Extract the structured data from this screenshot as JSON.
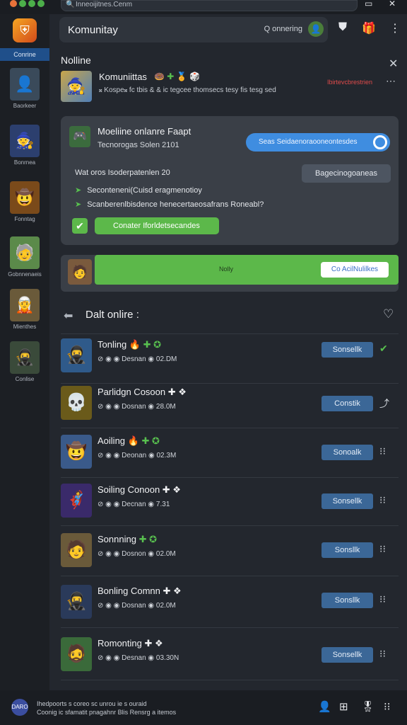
{
  "topbar": {
    "url": "Inneoijitnes.Cenm"
  },
  "rail": {
    "tab": "Conrine",
    "items": [
      {
        "label": "Baorkeer",
        "icon": "👤",
        "bg": "#3a4a5a"
      },
      {
        "label": "Bonrnea",
        "icon": "🧙",
        "bg": "#2c3f6e"
      },
      {
        "label": "Fonntag",
        "icon": "🤠",
        "bg": "#7a4a1a"
      },
      {
        "label": "Gobnnenaeis",
        "icon": "🧓",
        "bg": "#5b8a4a"
      },
      {
        "label": "Mienthes",
        "icon": "🧝",
        "bg": "#6a5a3a"
      },
      {
        "label": "Conlise",
        "icon": "🥷",
        "bg": "#3a4a3a"
      }
    ]
  },
  "header": {
    "title": "Komunitay",
    "search": "Q onnering"
  },
  "panel": {
    "title": "Nolline",
    "notif_name": "Komuniittas",
    "notif_sub": "𝄪 Kospe𝄪 fc tbis & & ic tegcee thomsecs tesy fis tesg sed",
    "notif_red": "Ibirtevcbrestrien"
  },
  "card": {
    "title": "Moeliine onlanre Faapt",
    "sub": "Tecnorogas Solen 2101",
    "pill": "Seas Seidaenoraooneontesdes",
    "question": "Wat oros Isoderpatenlen 20",
    "grey_btn": "Bagecinogoaneas",
    "bullet1": "Seconteneni(Cuisd eragmenotioy",
    "bullet2": "Scanberenlbisdence henecertaeosafrans Roneabl?",
    "green_btn": "Conater Iforldetsecandes"
  },
  "banner": {
    "label": "Nolly",
    "button": "Co AcilNulilkes"
  },
  "section": {
    "title": "Dalt onlire :"
  },
  "rows": [
    {
      "name": "Tonling",
      "badges": "🔥 ✚ ✪",
      "meta": "⊘ ◉  ◉ Desnan  ◉ 02.DM",
      "button": "Sonsellk",
      "end": "✔",
      "avatar": "🥷",
      "bg": "#2f5a8a"
    },
    {
      "name": "Parlidgn Cosoon ✚ ❖",
      "badges": "",
      "meta": "⊘ ◉  ◉ Dosnan  ◉ 28.0M",
      "button": "Constik",
      "end": "⤴",
      "avatar": "💀",
      "bg": "#6a5a1a"
    },
    {
      "name": "Aoiling",
      "badges": "🔥 ✚ ✪",
      "meta": "⊘ ◉  ◉ Deonan  ◉ 02.3M",
      "button": "Sonoalk",
      "end": "⁝⁝",
      "avatar": "🤠",
      "bg": "#3a5a8a"
    },
    {
      "name": "Soiling Conoon ✚ ❖",
      "badges": "",
      "meta": "⊘ ◉  ◉ Decnan  ◉ 7.31",
      "button": "Sonsellk",
      "end": "⁝⁝",
      "avatar": "🦸",
      "bg": "#3a2a6a"
    },
    {
      "name": "Sonnning",
      "badges": "✚ ✪",
      "meta": "⊘ ◉  ◉ Dosnon  ◉ 02.0M",
      "button": "Sonsllk",
      "end": "⁝⁝",
      "avatar": "🧑",
      "bg": "#6a5a3a"
    },
    {
      "name": "Bonling Comnn ✚ ❖",
      "badges": "",
      "meta": "⊘ ◉  ◉ Dosnan  ◉ 02.0M",
      "button": "Sonsllk",
      "end": "⁝⁝",
      "avatar": "🥷",
      "bg": "#2a3a5a"
    },
    {
      "name": "Romonting",
      "badges": "✚ ❖",
      "meta": "⊘ ◉  ◉ Desnan  ◉ 03.30N",
      "button": "Sonsellk",
      "end": "⁝⁝",
      "avatar": "🧔",
      "bg": "#3a6a3a"
    }
  ],
  "footer": {
    "line1": "Ihedpoorts s coreo sc unrou ie s ouraid",
    "line2": "Coonig ic sfamatit pnagahnr Blis Rensrg a itemos",
    "logo": "DARO"
  },
  "colors": {
    "accent_green": "#5cb84a",
    "accent_blue": "#3f8de0",
    "button_blue": "#3b6797",
    "danger": "#e04b4b"
  }
}
